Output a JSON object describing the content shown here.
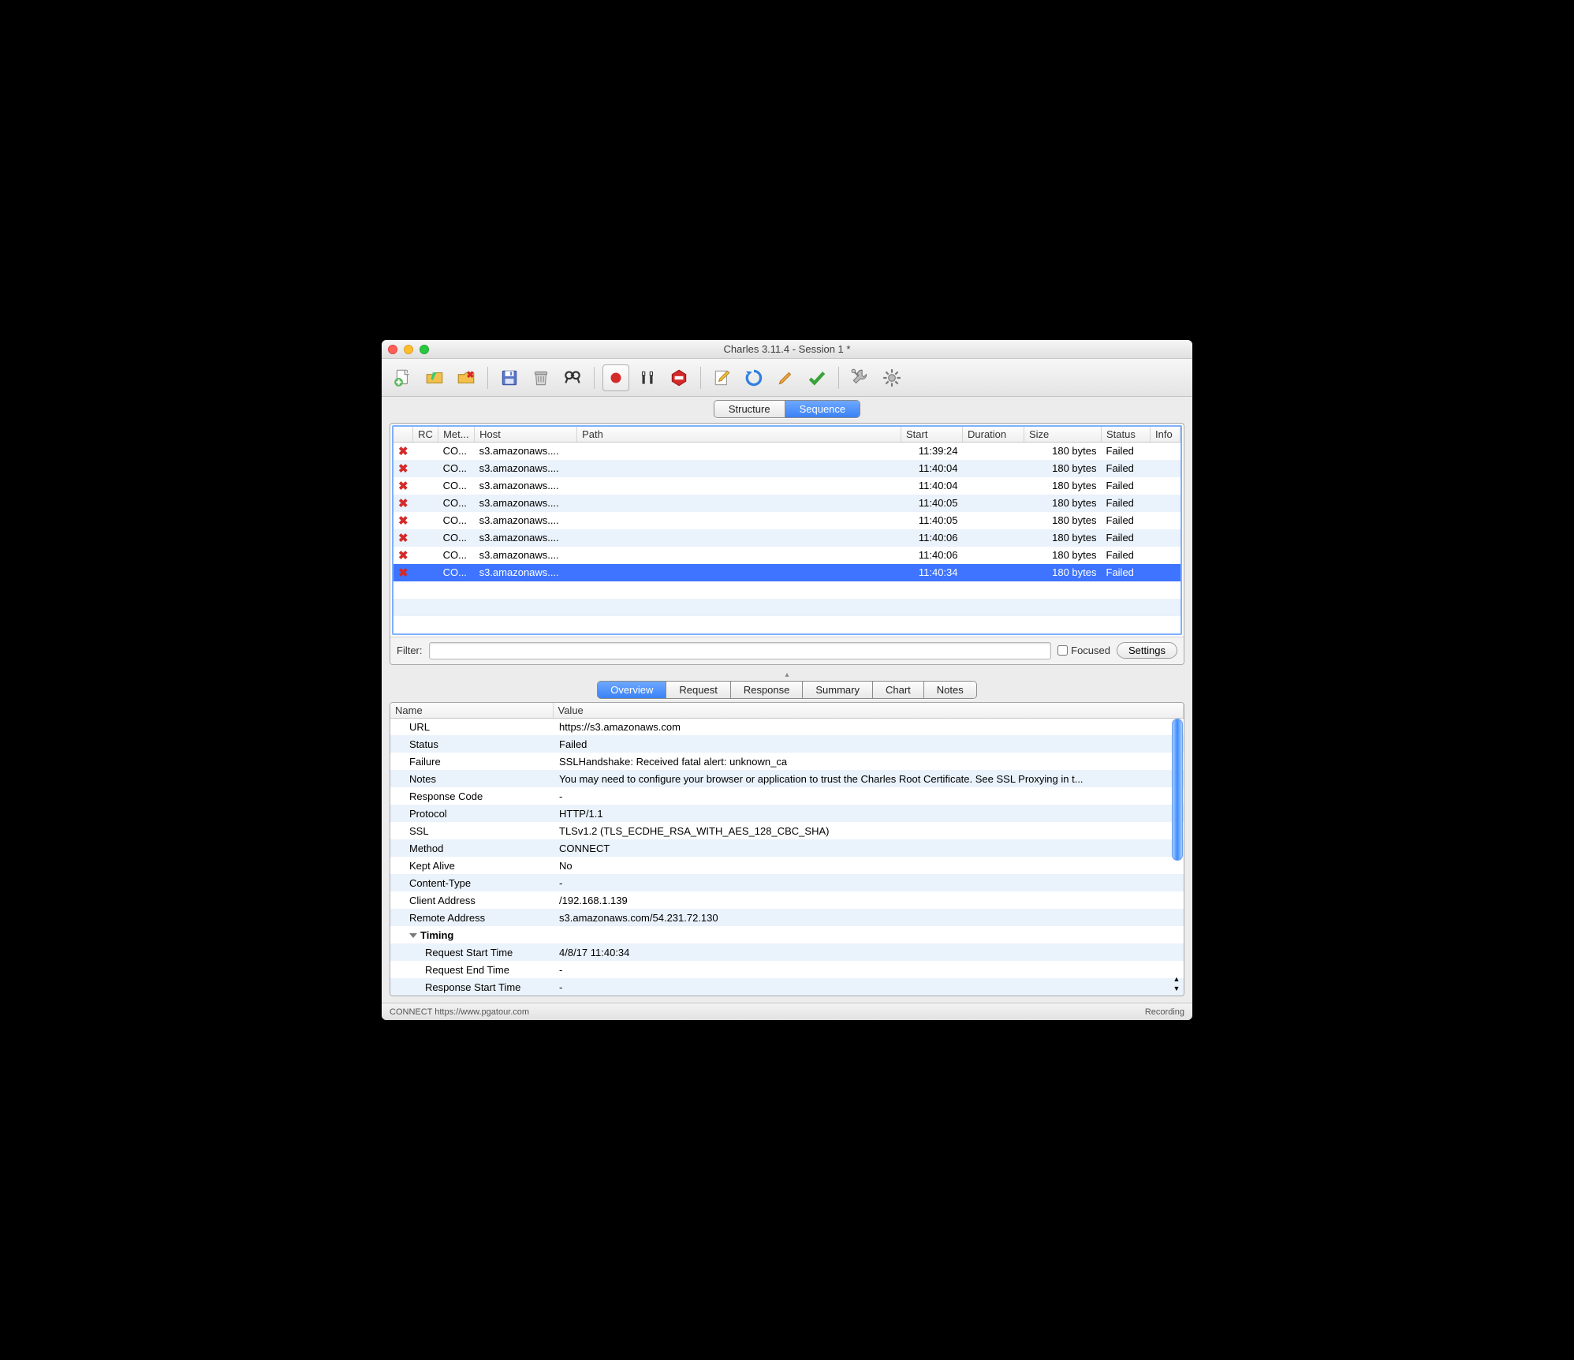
{
  "window": {
    "title": "Charles 3.11.4 - Session 1 *"
  },
  "viewTabs": {
    "structure": "Structure",
    "sequence": "Sequence"
  },
  "columns": [
    "",
    "RC",
    "Met...",
    "Host",
    "Path",
    "Start",
    "Duration",
    "Size",
    "Status",
    "Info"
  ],
  "rows": [
    {
      "method": "CO...",
      "host": "s3.amazonaws....",
      "path": "",
      "start": "11:39:24",
      "duration": "",
      "size": "180 bytes",
      "status": "Failed",
      "selected": false
    },
    {
      "method": "CO...",
      "host": "s3.amazonaws....",
      "path": "",
      "start": "11:40:04",
      "duration": "",
      "size": "180 bytes",
      "status": "Failed",
      "selected": false
    },
    {
      "method": "CO...",
      "host": "s3.amazonaws....",
      "path": "",
      "start": "11:40:04",
      "duration": "",
      "size": "180 bytes",
      "status": "Failed",
      "selected": false
    },
    {
      "method": "CO...",
      "host": "s3.amazonaws....",
      "path": "",
      "start": "11:40:05",
      "duration": "",
      "size": "180 bytes",
      "status": "Failed",
      "selected": false
    },
    {
      "method": "CO...",
      "host": "s3.amazonaws....",
      "path": "",
      "start": "11:40:05",
      "duration": "",
      "size": "180 bytes",
      "status": "Failed",
      "selected": false
    },
    {
      "method": "CO...",
      "host": "s3.amazonaws....",
      "path": "",
      "start": "11:40:06",
      "duration": "",
      "size": "180 bytes",
      "status": "Failed",
      "selected": false
    },
    {
      "method": "CO...",
      "host": "s3.amazonaws....",
      "path": "",
      "start": "11:40:06",
      "duration": "",
      "size": "180 bytes",
      "status": "Failed",
      "selected": false
    },
    {
      "method": "CO...",
      "host": "s3.amazonaws....",
      "path": "",
      "start": "11:40:34",
      "duration": "",
      "size": "180 bytes",
      "status": "Failed",
      "selected": true
    }
  ],
  "filter": {
    "label": "Filter:",
    "value": "",
    "focused": "Focused",
    "settings": "Settings"
  },
  "detailTabs": [
    "Overview",
    "Request",
    "Response",
    "Summary",
    "Chart",
    "Notes"
  ],
  "detailActive": 0,
  "detailHeaders": [
    "Name",
    "Value"
  ],
  "details": [
    {
      "name": "URL",
      "value": "https://s3.amazonaws.com",
      "indent": 1
    },
    {
      "name": "Status",
      "value": "Failed",
      "indent": 1
    },
    {
      "name": "Failure",
      "value": "SSLHandshake: Received fatal alert: unknown_ca",
      "indent": 1
    },
    {
      "name": "Notes",
      "value": "You may need to configure your browser or application to trust the Charles Root Certificate. See SSL Proxying in t...",
      "indent": 1
    },
    {
      "name": "Response Code",
      "value": "-",
      "indent": 1
    },
    {
      "name": "Protocol",
      "value": "HTTP/1.1",
      "indent": 1
    },
    {
      "name": "SSL",
      "value": "TLSv1.2 (TLS_ECDHE_RSA_WITH_AES_128_CBC_SHA)",
      "indent": 1
    },
    {
      "name": "Method",
      "value": "CONNECT",
      "indent": 1
    },
    {
      "name": "Kept Alive",
      "value": "No",
      "indent": 1
    },
    {
      "name": "Content-Type",
      "value": "-",
      "indent": 1
    },
    {
      "name": "Client Address",
      "value": "/192.168.1.139",
      "indent": 1
    },
    {
      "name": "Remote Address",
      "value": "s3.amazonaws.com/54.231.72.130",
      "indent": 1
    },
    {
      "name": "Timing",
      "value": "",
      "indent": 1,
      "bold": true,
      "disclose": true
    },
    {
      "name": "Request Start Time",
      "value": "4/8/17 11:40:34",
      "indent": 2
    },
    {
      "name": "Request End Time",
      "value": "-",
      "indent": 2
    },
    {
      "name": "Response Start Time",
      "value": "-",
      "indent": 2
    }
  ],
  "statusbar": {
    "left": "CONNECT https://www.pgatour.com",
    "right": "Recording"
  }
}
